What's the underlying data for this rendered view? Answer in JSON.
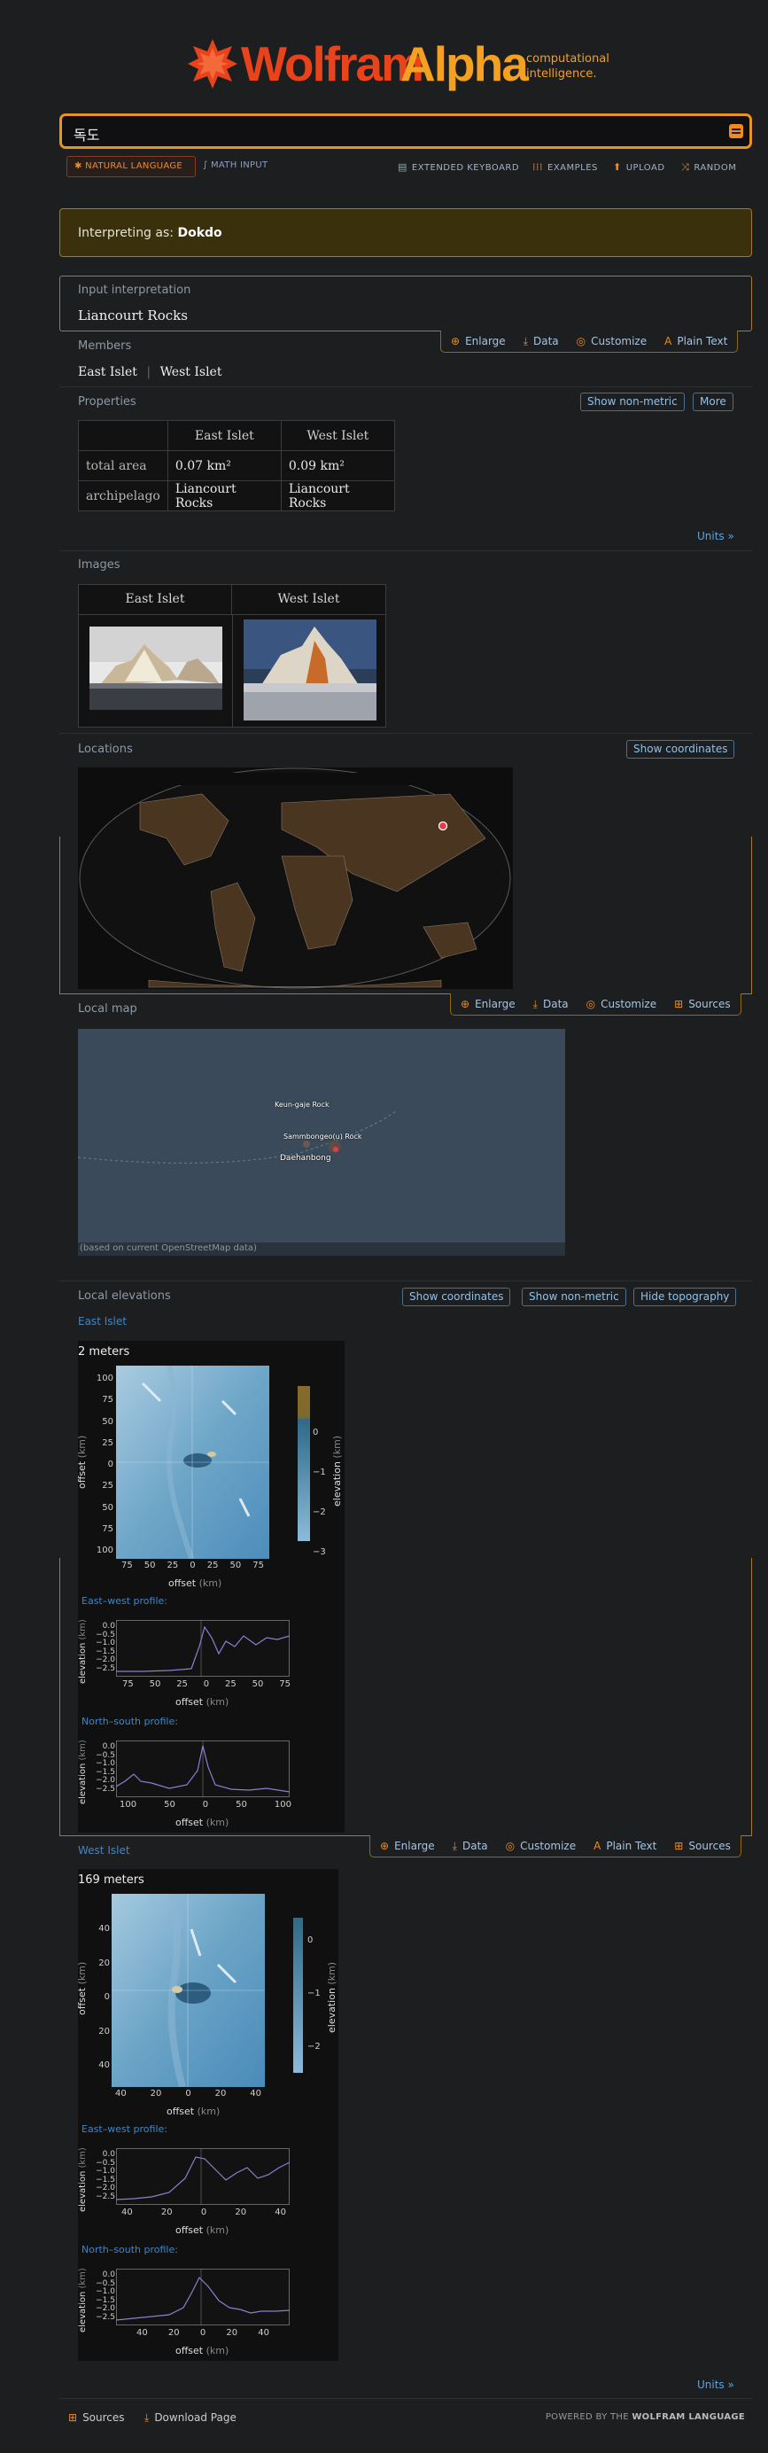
{
  "header": {
    "logo_wolfram": "Wolfram",
    "logo_alpha": "Alpha",
    "tagline_1": "computational",
    "tagline_2": "intelligence."
  },
  "search": {
    "value": "독도"
  },
  "modes": {
    "natural": "NATURAL LANGUAGE",
    "math": "MATH INPUT"
  },
  "topnav": {
    "keyboard": "EXTENDED KEYBOARD",
    "examples": "EXAMPLES",
    "upload": "UPLOAD",
    "random": "RANDOM"
  },
  "interpreting": {
    "prefix": "Interpreting as:",
    "value": "Dokdo"
  },
  "input_pod": {
    "title": "Input interpretation",
    "value": "Liancourt Rocks"
  },
  "pod_buttons": {
    "enlarge": "Enlarge",
    "data": "Data",
    "customize": "Customize",
    "plain_text": "Plain Text",
    "sources": "Sources"
  },
  "members": {
    "title": "Members",
    "items": [
      "East Islet",
      "West Islet"
    ],
    "divider": "|"
  },
  "properties": {
    "title": "Properties",
    "toggle_nonmetric": "Show non-metric",
    "toggle_more": "More",
    "headers": [
      "East Islet",
      "West Islet"
    ],
    "rows": [
      {
        "label": "total area",
        "east": "0.07 km²",
        "west": "0.09 km²"
      },
      {
        "label": "archipelago",
        "east": "Liancourt Rocks",
        "west": "Liancourt Rocks"
      }
    ],
    "units_link": "Units »"
  },
  "images": {
    "title": "Images",
    "headers": [
      "East Islet",
      "West Islet"
    ]
  },
  "locations": {
    "title": "Locations",
    "toggle": "Show coordinates"
  },
  "local_map": {
    "title": "Local map",
    "labels": [
      "Keun-gaje Rock",
      "Sammbongeo(u) Rock",
      "Daehanbong"
    ],
    "caption": "(based on current OpenStreetMap data)"
  },
  "elevations": {
    "title": "Local elevations",
    "toggle_coords": "Show coordinates",
    "toggle_nonmetric": "Show non-metric",
    "toggle_topo": "Hide topography",
    "east": {
      "label": "East Islet",
      "elevation": "2 meters",
      "y_ticks": [
        "100",
        "75",
        "50",
        "25",
        "0",
        "25",
        "50",
        "75",
        "100"
      ],
      "x_ticks": [
        "75",
        "50",
        "25",
        "0",
        "25",
        "50",
        "75"
      ],
      "cbar_ticks": [
        "0",
        "−1",
        "−2",
        "−3"
      ],
      "ew_title": "East–west profile:",
      "ns_title": "North–south profile:",
      "ew_x": [
        "75",
        "50",
        "25",
        "0",
        "25",
        "50",
        "75"
      ],
      "ns_x": [
        "100",
        "50",
        "0",
        "50",
        "100"
      ],
      "prof_y": [
        "0.0",
        "−0.5",
        "−1.0",
        "−1.5",
        "−2.0",
        "−2.5"
      ]
    },
    "west": {
      "label": "West Islet",
      "elevation": "169 meters",
      "y_ticks": [
        "40",
        "20",
        "0",
        "20",
        "40"
      ],
      "x_ticks": [
        "40",
        "20",
        "0",
        "20",
        "40"
      ],
      "cbar_ticks": [
        "0",
        "−1",
        "−2"
      ],
      "ew_title": "East–west profile:",
      "ns_title": "North–south profile:",
      "ew_x": [
        "40",
        "20",
        "0",
        "20",
        "40"
      ],
      "ns_x": [
        "40",
        "20",
        "0",
        "20",
        "40"
      ],
      "prof_y": [
        "0.0",
        "−0.5",
        "−1.0",
        "−1.5",
        "−2.0",
        "−2.5"
      ]
    },
    "axis_offset": "offset",
    "axis_km": "(km)",
    "axis_elev": "elevation",
    "units_link": "Units »"
  },
  "footer": {
    "sources": "Sources",
    "download": "Download Page",
    "powered_prefix": "POWERED BY THE",
    "powered_brand": "WOLFRAM LANGUAGE"
  },
  "colors": {
    "brand_red": "#e9431b",
    "brand_orange": "#f4a020",
    "frame": "#a77b16",
    "link": "#5fa4dc"
  }
}
